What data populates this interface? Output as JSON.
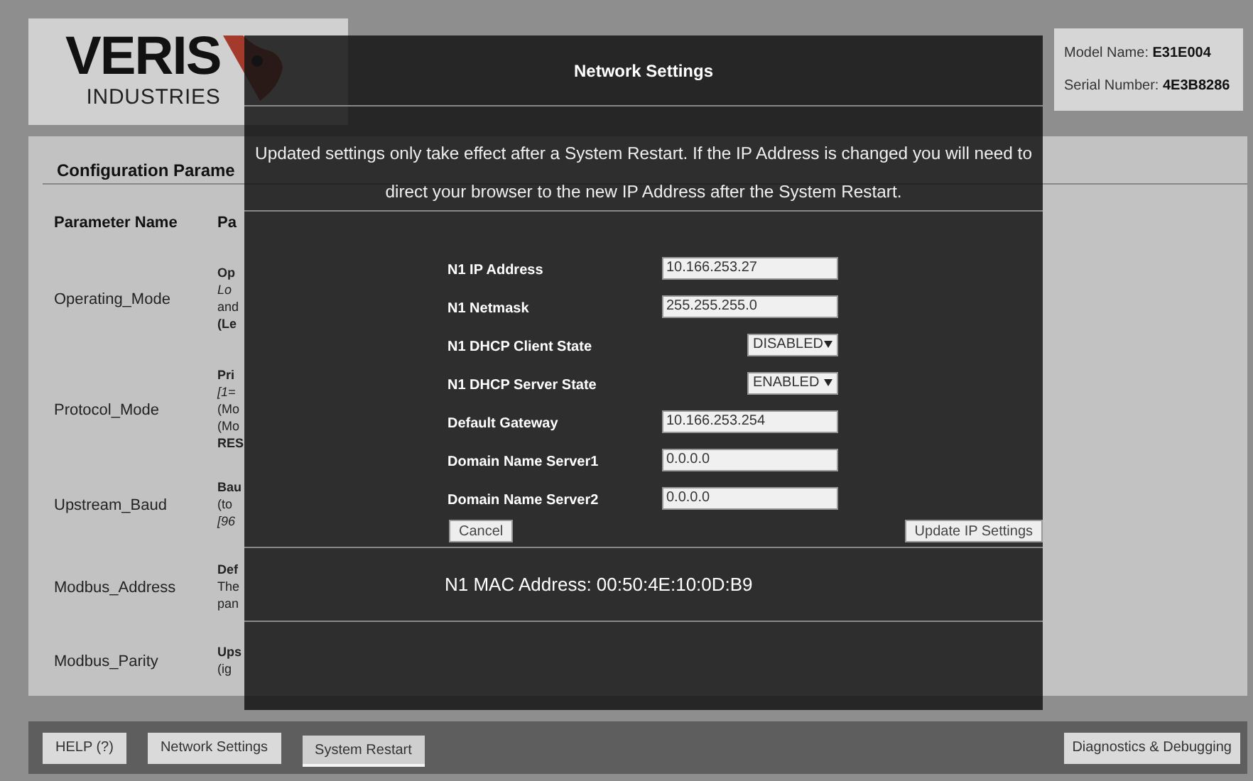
{
  "logo": {
    "word": "VERIS",
    "subword": "INDUSTRIES"
  },
  "device_info": [
    {
      "label": "Model Name: ",
      "value": "E31E004"
    },
    {
      "label": "Serial Number: ",
      "value": "4E3B8286"
    }
  ],
  "config": {
    "title": "Configuration Parame",
    "columns": [
      "Parameter Name",
      "Pa"
    ],
    "rows": [
      {
        "name": "Operating_Mode",
        "description": [
          {
            "text": "Op",
            "kind": "heading"
          },
          {
            "text": "Lo",
            "kind": "range"
          },
          {
            "text": "and",
            "kind": "note"
          },
          {
            "text": "(Le",
            "kind": "heading"
          }
        ]
      },
      {
        "name": "Protocol_Mode",
        "description": [
          {
            "text": "Pri",
            "kind": "heading"
          },
          {
            "text": "[1=",
            "kind": "range"
          },
          {
            "text": "(Mo",
            "kind": "note"
          },
          {
            "text": "(Mo",
            "kind": "note"
          },
          {
            "text": "RES",
            "kind": "heading"
          }
        ]
      },
      {
        "name": "Upstream_Baud",
        "description": [
          {
            "text": "Bau",
            "kind": "heading"
          },
          {
            "text": "(to",
            "kind": "note"
          },
          {
            "text": "[96",
            "kind": "range"
          }
        ]
      },
      {
        "name": "Modbus_Address",
        "description": [
          {
            "text": "Def",
            "kind": "heading"
          },
          {
            "text": "The",
            "kind": "note"
          },
          {
            "text": "pan",
            "kind": "note"
          }
        ]
      },
      {
        "name": "Modbus_Parity",
        "description": [
          {
            "text": "Ups",
            "kind": "heading"
          },
          {
            "text": "(ig",
            "kind": "note"
          }
        ]
      }
    ]
  },
  "bottom_buttons": [
    {
      "label": "HELP (?)",
      "selected": false
    },
    {
      "label": "Network Settings",
      "selected": false
    },
    {
      "label": "System Restart",
      "selected": true
    }
  ],
  "diagnostics_button": "Diagnostics & Debugging",
  "modal": {
    "title": "Network Settings",
    "message": "Updated settings only take effect after a System Restart. If the IP Address is changed you will need to direct your browser to the new IP Address after the System Restart.",
    "fields": [
      {
        "label": "N1 IP Address",
        "kind": "text",
        "value": "10.166.253.27"
      },
      {
        "label": "N1 Netmask",
        "kind": "text",
        "value": "255.255.255.0"
      },
      {
        "label": "N1 DHCP Client State",
        "kind": "select",
        "value": "DISABLED"
      },
      {
        "label": "N1 DHCP Server State",
        "kind": "select",
        "value": "ENABLED"
      },
      {
        "label": "Default Gateway",
        "kind": "text",
        "value": "10.166.253.254"
      },
      {
        "label": "Domain Name Server1",
        "kind": "text",
        "value": "0.0.0.0"
      },
      {
        "label": "Domain Name Server2",
        "kind": "text",
        "value": "0.0.0.0"
      }
    ],
    "cancel": "Cancel",
    "update": "Update IP Settings",
    "mac": "N1 MAC Address: 00:50:4E:10:0D:B9"
  }
}
